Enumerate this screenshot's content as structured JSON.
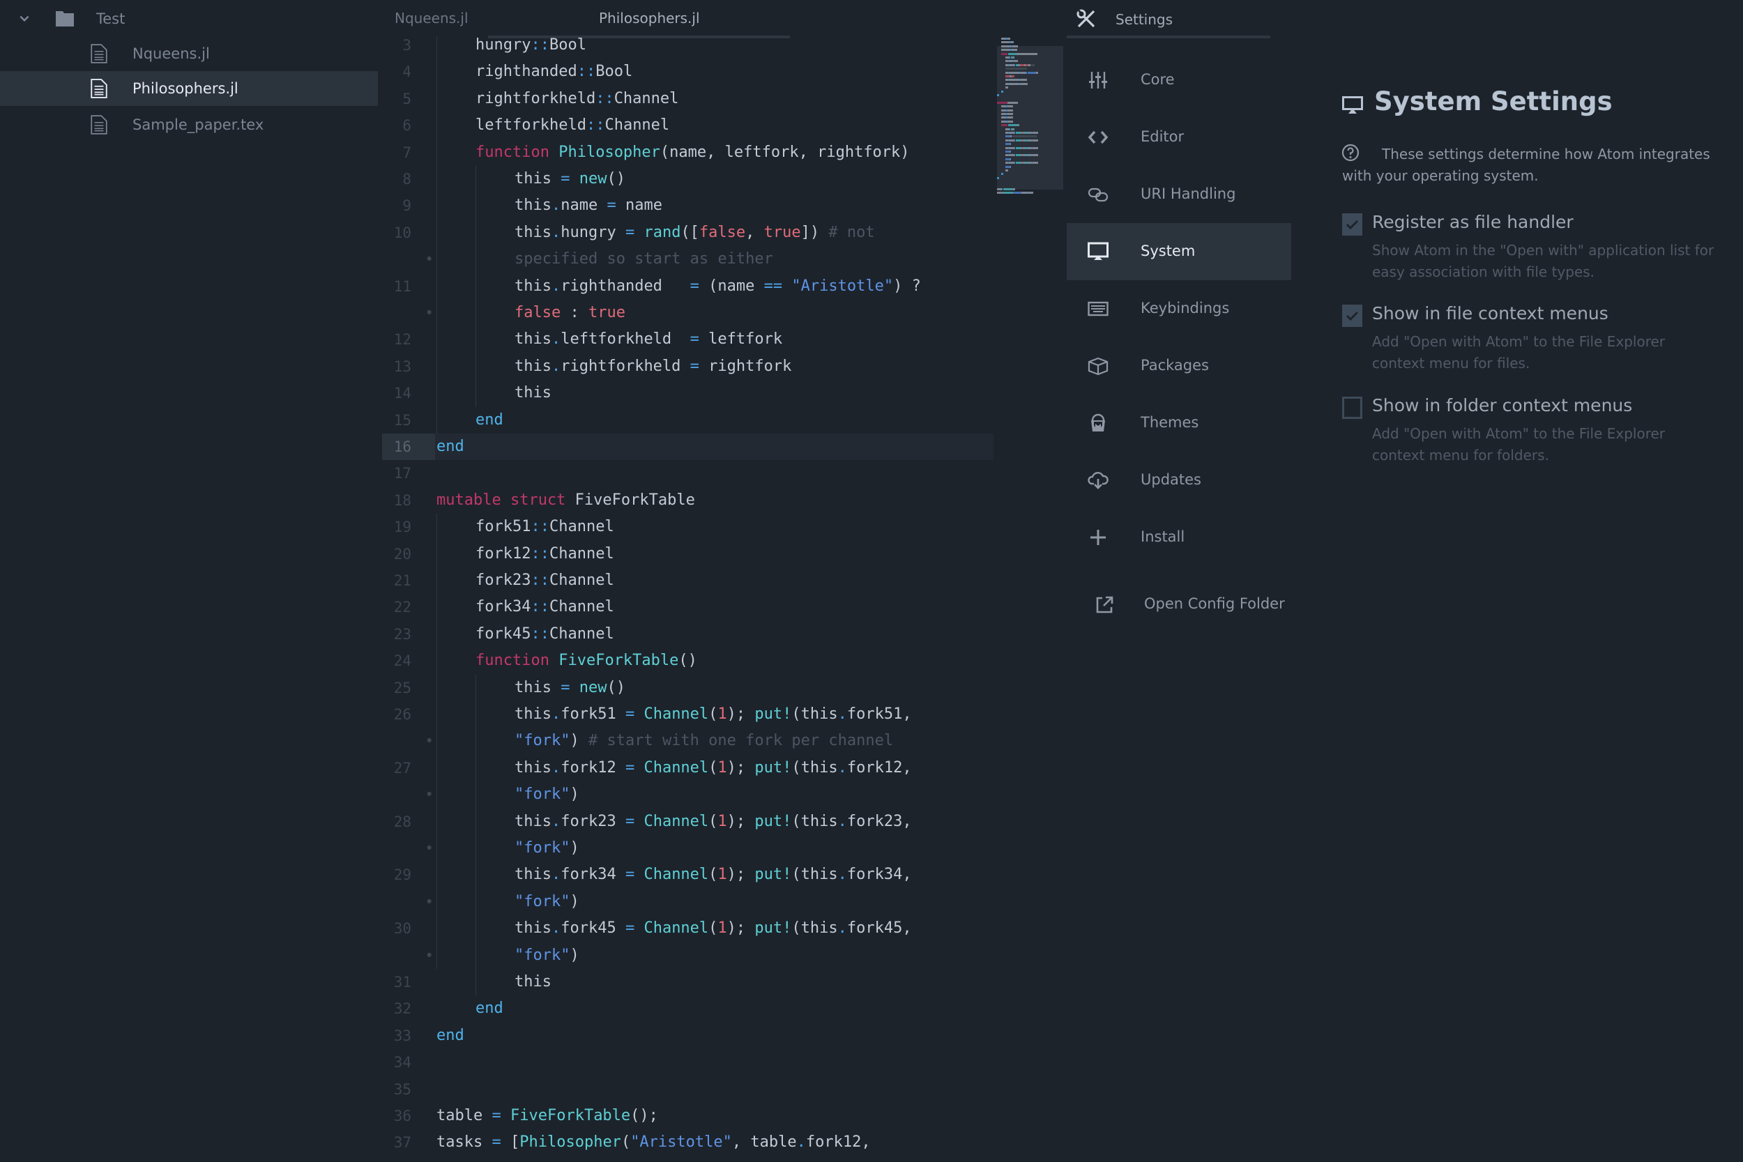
{
  "tree": {
    "root": {
      "label": "Test",
      "icon": "folder-icon",
      "expanded": true
    },
    "files": [
      {
        "label": "Nqueens.jl",
        "icon": "file-text-icon",
        "selected": false
      },
      {
        "label": "Philosophers.jl",
        "icon": "file-text-icon",
        "selected": true
      },
      {
        "label": "Sample_paper.tex",
        "icon": "file-text-icon",
        "selected": false
      }
    ]
  },
  "tabs": [
    {
      "label": "Nqueens.jl",
      "active": false
    },
    {
      "label": "Philosophers.jl",
      "active": true
    },
    {
      "label": "Settings",
      "active": false,
      "icon": "tools-icon"
    }
  ],
  "editor": {
    "cursor_line": 16,
    "lines": [
      {
        "n": "3",
        "indent": 1,
        "tokens": [
          [
            "",
            "hungry"
          ],
          [
            "op",
            "::"
          ],
          [
            "",
            "Bool"
          ]
        ]
      },
      {
        "n": "4",
        "indent": 1,
        "tokens": [
          [
            "",
            "righthanded"
          ],
          [
            "op",
            "::"
          ],
          [
            "",
            "Bool"
          ]
        ]
      },
      {
        "n": "5",
        "indent": 1,
        "tokens": [
          [
            "",
            "rightforkheld"
          ],
          [
            "op",
            "::"
          ],
          [
            "",
            "Channel"
          ]
        ]
      },
      {
        "n": "6",
        "indent": 1,
        "tokens": [
          [
            "",
            "leftforkheld"
          ],
          [
            "op",
            "::"
          ],
          [
            "",
            "Channel"
          ]
        ]
      },
      {
        "n": "7",
        "indent": 1,
        "tokens": [
          [
            "kw",
            "function"
          ],
          [
            "",
            " "
          ],
          [
            "fn",
            "Philosopher"
          ],
          [
            "",
            "(name, leftfork, rightfork)"
          ]
        ]
      },
      {
        "n": "8",
        "indent": 2,
        "tokens": [
          [
            "",
            "this "
          ],
          [
            "op",
            "="
          ],
          [
            "",
            " "
          ],
          [
            "fn",
            "new"
          ],
          [
            "",
            "()"
          ]
        ]
      },
      {
        "n": "9",
        "indent": 2,
        "tokens": [
          [
            "",
            "this"
          ],
          [
            "op",
            "."
          ],
          [
            "",
            "name "
          ],
          [
            "op",
            "="
          ],
          [
            "",
            " name"
          ]
        ]
      },
      {
        "n": "10",
        "indent": 2,
        "tokens": [
          [
            "",
            "this"
          ],
          [
            "op",
            "."
          ],
          [
            "",
            "hungry "
          ],
          [
            "op",
            "="
          ],
          [
            "",
            " "
          ],
          [
            "fn",
            "rand"
          ],
          [
            "",
            "(["
          ],
          [
            "bool",
            "false"
          ],
          [
            "",
            ", "
          ],
          [
            "bool",
            "true"
          ],
          [
            "",
            "]) "
          ],
          [
            "cm",
            "# not"
          ]
        ]
      },
      {
        "n": "•",
        "indent": 2,
        "tokens": [
          [
            "cm",
            "specified so start as either"
          ]
        ]
      },
      {
        "n": "11",
        "indent": 2,
        "tokens": [
          [
            "",
            "this"
          ],
          [
            "op",
            "."
          ],
          [
            "",
            "righthanded   "
          ],
          [
            "op",
            "="
          ],
          [
            "",
            " (name "
          ],
          [
            "op",
            "=="
          ],
          [
            "",
            " "
          ],
          [
            "str",
            "\"Aristotle\""
          ],
          [
            "",
            ") ?"
          ]
        ]
      },
      {
        "n": "•",
        "indent": 2,
        "tokens": [
          [
            "bool",
            "false"
          ],
          [
            "",
            " : "
          ],
          [
            "bool",
            "true"
          ]
        ]
      },
      {
        "n": "12",
        "indent": 2,
        "tokens": [
          [
            "",
            "this"
          ],
          [
            "op",
            "."
          ],
          [
            "",
            "leftforkheld  "
          ],
          [
            "op",
            "="
          ],
          [
            "",
            " leftfork"
          ]
        ]
      },
      {
        "n": "13",
        "indent": 2,
        "tokens": [
          [
            "",
            "this"
          ],
          [
            "op",
            "."
          ],
          [
            "",
            "rightforkheld "
          ],
          [
            "op",
            "="
          ],
          [
            "",
            " rightfork"
          ]
        ]
      },
      {
        "n": "14",
        "indent": 2,
        "tokens": [
          [
            "",
            "this"
          ]
        ]
      },
      {
        "n": "15",
        "indent": 1,
        "tokens": [
          [
            "end",
            "end"
          ]
        ]
      },
      {
        "n": "16",
        "indent": 0,
        "tokens": [
          [
            "end",
            "end"
          ]
        ]
      },
      {
        "n": "17",
        "indent": 0,
        "tokens": []
      },
      {
        "n": "18",
        "indent": 0,
        "tokens": [
          [
            "kw",
            "mutable struct"
          ],
          [
            "",
            " FiveForkTable"
          ]
        ]
      },
      {
        "n": "19",
        "indent": 1,
        "tokens": [
          [
            "",
            "fork51"
          ],
          [
            "op",
            "::"
          ],
          [
            "",
            "Channel"
          ]
        ]
      },
      {
        "n": "20",
        "indent": 1,
        "tokens": [
          [
            "",
            "fork12"
          ],
          [
            "op",
            "::"
          ],
          [
            "",
            "Channel"
          ]
        ]
      },
      {
        "n": "21",
        "indent": 1,
        "tokens": [
          [
            "",
            "fork23"
          ],
          [
            "op",
            "::"
          ],
          [
            "",
            "Channel"
          ]
        ]
      },
      {
        "n": "22",
        "indent": 1,
        "tokens": [
          [
            "",
            "fork34"
          ],
          [
            "op",
            "::"
          ],
          [
            "",
            "Channel"
          ]
        ]
      },
      {
        "n": "23",
        "indent": 1,
        "tokens": [
          [
            "",
            "fork45"
          ],
          [
            "op",
            "::"
          ],
          [
            "",
            "Channel"
          ]
        ]
      },
      {
        "n": "24",
        "indent": 1,
        "tokens": [
          [
            "kw",
            "function"
          ],
          [
            "",
            " "
          ],
          [
            "fn",
            "FiveForkTable"
          ],
          [
            "",
            "()"
          ]
        ]
      },
      {
        "n": "25",
        "indent": 2,
        "tokens": [
          [
            "",
            "this "
          ],
          [
            "op",
            "="
          ],
          [
            "",
            " "
          ],
          [
            "fn",
            "new"
          ],
          [
            "",
            "()"
          ]
        ]
      },
      {
        "n": "26",
        "indent": 2,
        "tokens": [
          [
            "",
            "this"
          ],
          [
            "op",
            "."
          ],
          [
            "",
            "fork51 "
          ],
          [
            "op",
            "="
          ],
          [
            "",
            " "
          ],
          [
            "fn",
            "Channel"
          ],
          [
            "",
            "("
          ],
          [
            "num",
            "1"
          ],
          [
            "",
            "); "
          ],
          [
            "fn",
            "put!"
          ],
          [
            "",
            "(this"
          ],
          [
            "op",
            "."
          ],
          [
            "",
            "fork51,"
          ]
        ]
      },
      {
        "n": "•",
        "indent": 2,
        "tokens": [
          [
            "str",
            "\"fork\""
          ],
          [
            "",
            ") "
          ],
          [
            "cm",
            "# start with one fork per channel"
          ]
        ]
      },
      {
        "n": "27",
        "indent": 2,
        "tokens": [
          [
            "",
            "this"
          ],
          [
            "op",
            "."
          ],
          [
            "",
            "fork12 "
          ],
          [
            "op",
            "="
          ],
          [
            "",
            " "
          ],
          [
            "fn",
            "Channel"
          ],
          [
            "",
            "("
          ],
          [
            "num",
            "1"
          ],
          [
            "",
            "); "
          ],
          [
            "fn",
            "put!"
          ],
          [
            "",
            "(this"
          ],
          [
            "op",
            "."
          ],
          [
            "",
            "fork12,"
          ]
        ]
      },
      {
        "n": "•",
        "indent": 2,
        "tokens": [
          [
            "str",
            "\"fork\""
          ],
          [
            "",
            ")"
          ]
        ]
      },
      {
        "n": "28",
        "indent": 2,
        "tokens": [
          [
            "",
            "this"
          ],
          [
            "op",
            "."
          ],
          [
            "",
            "fork23 "
          ],
          [
            "op",
            "="
          ],
          [
            "",
            " "
          ],
          [
            "fn",
            "Channel"
          ],
          [
            "",
            "("
          ],
          [
            "num",
            "1"
          ],
          [
            "",
            "); "
          ],
          [
            "fn",
            "put!"
          ],
          [
            "",
            "(this"
          ],
          [
            "op",
            "."
          ],
          [
            "",
            "fork23,"
          ]
        ]
      },
      {
        "n": "•",
        "indent": 2,
        "tokens": [
          [
            "str",
            "\"fork\""
          ],
          [
            "",
            ")"
          ]
        ]
      },
      {
        "n": "29",
        "indent": 2,
        "tokens": [
          [
            "",
            "this"
          ],
          [
            "op",
            "."
          ],
          [
            "",
            "fork34 "
          ],
          [
            "op",
            "="
          ],
          [
            "",
            " "
          ],
          [
            "fn",
            "Channel"
          ],
          [
            "",
            "("
          ],
          [
            "num",
            "1"
          ],
          [
            "",
            "); "
          ],
          [
            "fn",
            "put!"
          ],
          [
            "",
            "(this"
          ],
          [
            "op",
            "."
          ],
          [
            "",
            "fork34,"
          ]
        ]
      },
      {
        "n": "•",
        "indent": 2,
        "tokens": [
          [
            "str",
            "\"fork\""
          ],
          [
            "",
            ")"
          ]
        ]
      },
      {
        "n": "30",
        "indent": 2,
        "tokens": [
          [
            "",
            "this"
          ],
          [
            "op",
            "."
          ],
          [
            "",
            "fork45 "
          ],
          [
            "op",
            "="
          ],
          [
            "",
            " "
          ],
          [
            "fn",
            "Channel"
          ],
          [
            "",
            "("
          ],
          [
            "num",
            "1"
          ],
          [
            "",
            "); "
          ],
          [
            "fn",
            "put!"
          ],
          [
            "",
            "(this"
          ],
          [
            "op",
            "."
          ],
          [
            "",
            "fork45,"
          ]
        ]
      },
      {
        "n": "•",
        "indent": 2,
        "tokens": [
          [
            "str",
            "\"fork\""
          ],
          [
            "",
            ")"
          ]
        ]
      },
      {
        "n": "31",
        "indent": 2,
        "tokens": [
          [
            "",
            "this"
          ]
        ]
      },
      {
        "n": "32",
        "indent": 1,
        "tokens": [
          [
            "end",
            "end"
          ]
        ]
      },
      {
        "n": "33",
        "indent": 0,
        "tokens": [
          [
            "end",
            "end"
          ]
        ]
      },
      {
        "n": "34",
        "indent": 0,
        "tokens": []
      },
      {
        "n": "35",
        "indent": 0,
        "tokens": []
      },
      {
        "n": "36",
        "indent": 0,
        "tokens": [
          [
            "",
            "table "
          ],
          [
            "op",
            "="
          ],
          [
            "",
            " "
          ],
          [
            "fn",
            "FiveForkTable"
          ],
          [
            "",
            "();"
          ]
        ]
      },
      {
        "n": "37",
        "indent": 0,
        "tokens": [
          [
            "",
            "tasks "
          ],
          [
            "op",
            "="
          ],
          [
            "",
            " ["
          ],
          [
            "fn",
            "Philosopher"
          ],
          [
            "",
            "("
          ],
          [
            "str",
            "\"Aristotle\""
          ],
          [
            "",
            ", table"
          ],
          [
            "op",
            "."
          ],
          [
            "",
            "fork12,"
          ]
        ]
      }
    ]
  },
  "settings_nav": {
    "header": {
      "label": "Settings",
      "icon": "tools-icon"
    },
    "items": [
      {
        "label": "Core",
        "icon": "sliders-icon",
        "active": false
      },
      {
        "label": "Editor",
        "icon": "code-icon",
        "active": false
      },
      {
        "label": "URI Handling",
        "icon": "link-icon",
        "active": false
      },
      {
        "label": "System",
        "icon": "monitor-icon",
        "active": true
      },
      {
        "label": "Keybindings",
        "icon": "keyboard-icon",
        "active": false
      },
      {
        "label": "Packages",
        "icon": "package-icon",
        "active": false
      },
      {
        "label": "Themes",
        "icon": "paintcan-icon",
        "active": false
      },
      {
        "label": "Updates",
        "icon": "cloud-download-icon",
        "active": false
      },
      {
        "label": "Install",
        "icon": "plus-icon",
        "active": false
      }
    ],
    "open_config": {
      "label": "Open Config Folder",
      "icon": "link-external-icon"
    }
  },
  "system_settings": {
    "title": "System Settings",
    "description": "These settings determine how Atom integrates with your operating system.",
    "options": [
      {
        "label": "Register as file handler",
        "checked": true,
        "description": "Show Atom in the \"Open with\" application list for easy association with file types."
      },
      {
        "label": "Show in file context menus",
        "checked": true,
        "description": "Add \"Open with Atom\" to the File Explorer context menu for files."
      },
      {
        "label": "Show in folder context menus",
        "checked": false,
        "description": "Add \"Open with Atom\" to the File Explorer context menu for folders."
      }
    ]
  },
  "colors": {
    "background": "#1d232b",
    "selection": "#2b333d",
    "keyword": "#c2386a",
    "function": "#5ed1d6",
    "operator": "#4fa3e6",
    "boolean": "#e06c7a",
    "string": "#5e94e6",
    "comment": "#4c5562",
    "checkbox": "#3d4a59"
  }
}
